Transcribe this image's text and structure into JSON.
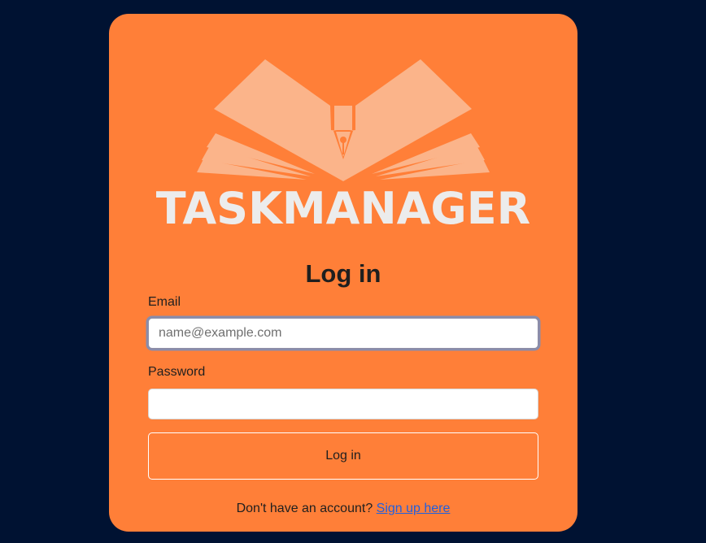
{
  "logo": {
    "icon": "open-book-pen-nib-icon",
    "text": "TASKMANAGER",
    "icon_color": "#fbb48a",
    "text_color": "#ececec"
  },
  "form": {
    "heading": "Log in",
    "email_label": "Email",
    "email_placeholder": "name@example.com",
    "email_value": "",
    "password_label": "Password",
    "password_value": "",
    "submit_label": "Log in"
  },
  "footer": {
    "prompt": "Don't have an account?",
    "signup_link": "Sign up here"
  },
  "colors": {
    "page_background": "#001232",
    "card_background": "#ff7f38",
    "link": "#1f5fe0"
  }
}
